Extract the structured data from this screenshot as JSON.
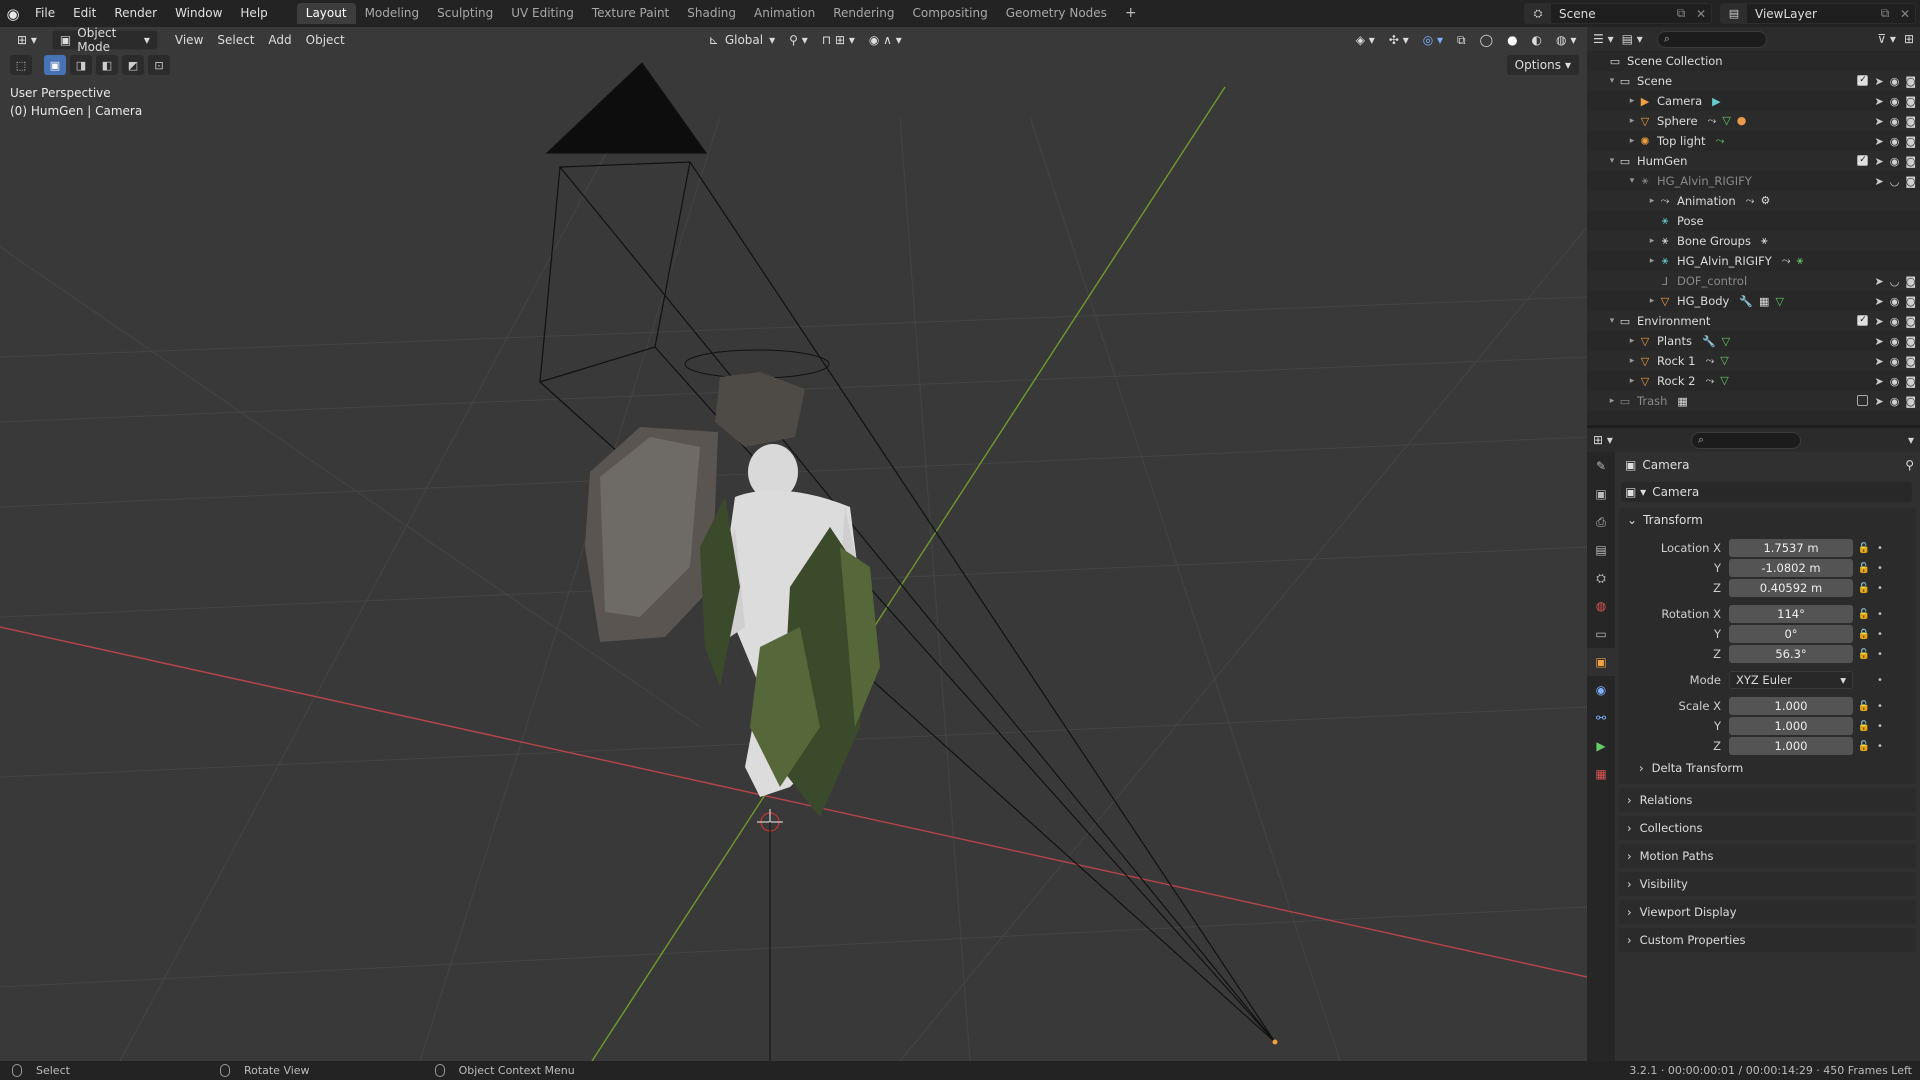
{
  "menu": [
    "File",
    "Edit",
    "Render",
    "Window",
    "Help"
  ],
  "workspaces": [
    "Layout",
    "Modeling",
    "Sculpting",
    "UV Editing",
    "Texture Paint",
    "Shading",
    "Animation",
    "Rendering",
    "Compositing",
    "Geometry Nodes"
  ],
  "active_workspace": "Layout",
  "scene_name": "Scene",
  "view_layer": "ViewLayer",
  "viewport": {
    "mode": "Object Mode",
    "menus": [
      "View",
      "Select",
      "Add",
      "Object"
    ],
    "orientation": "Global",
    "options": "Options",
    "perspective_label": "User Perspective",
    "active_label": "(0) HumGen | Camera"
  },
  "outliner": {
    "root": "Scene Collection",
    "rows": [
      {
        "name": "Scene",
        "type": "collection"
      },
      {
        "name": "Camera",
        "type": "camera"
      },
      {
        "name": "Sphere",
        "type": "mesh"
      },
      {
        "name": "Top light",
        "type": "light"
      },
      {
        "name": "HumGen",
        "type": "collection"
      },
      {
        "name": "HG_Alvin_RIGIFY",
        "type": "armature"
      },
      {
        "name": "Animation",
        "type": "data"
      },
      {
        "name": "Pose",
        "type": "data"
      },
      {
        "name": "Bone Groups",
        "type": "data"
      },
      {
        "name": "HG_Alvin_RIGIFY",
        "type": "armature-data"
      },
      {
        "name": "DOF_control",
        "type": "empty"
      },
      {
        "name": "HG_Body",
        "type": "mesh"
      },
      {
        "name": "Environment",
        "type": "collection"
      },
      {
        "name": "Plants",
        "type": "mesh"
      },
      {
        "name": "Rock 1",
        "type": "mesh"
      },
      {
        "name": "Rock 2",
        "type": "mesh"
      },
      {
        "name": "Trash",
        "type": "collection"
      }
    ]
  },
  "properties": {
    "context": "Camera",
    "object_name": "Camera",
    "transform_label": "Transform",
    "location_label": "Location X",
    "location": [
      "1.7537 m",
      "-1.0802 m",
      "0.40592 m"
    ],
    "rotation_label": "Rotation X",
    "rotation": [
      "114°",
      "0°",
      "56.3°"
    ],
    "mode_label": "Mode",
    "mode": "XYZ Euler",
    "scale_label": "Scale X",
    "scale": [
      "1.000",
      "1.000",
      "1.000"
    ],
    "axis_y": "Y",
    "axis_z": "Z",
    "delta": "Delta Transform",
    "panels": [
      "Relations",
      "Collections",
      "Motion Paths",
      "Visibility",
      "Viewport Display",
      "Custom Properties"
    ]
  },
  "status": {
    "select": "Select",
    "rotate": "Rotate View",
    "context": "Object Context Menu",
    "info": "3.2.1 · 00:00:00:01 / 00:00:14:29 · 450 Frames Left"
  },
  "colors": {
    "accent": "#4772b3",
    "x_axis": "#b8444b",
    "y_axis": "#6e9a2c",
    "camera_active": "#f0a040"
  }
}
